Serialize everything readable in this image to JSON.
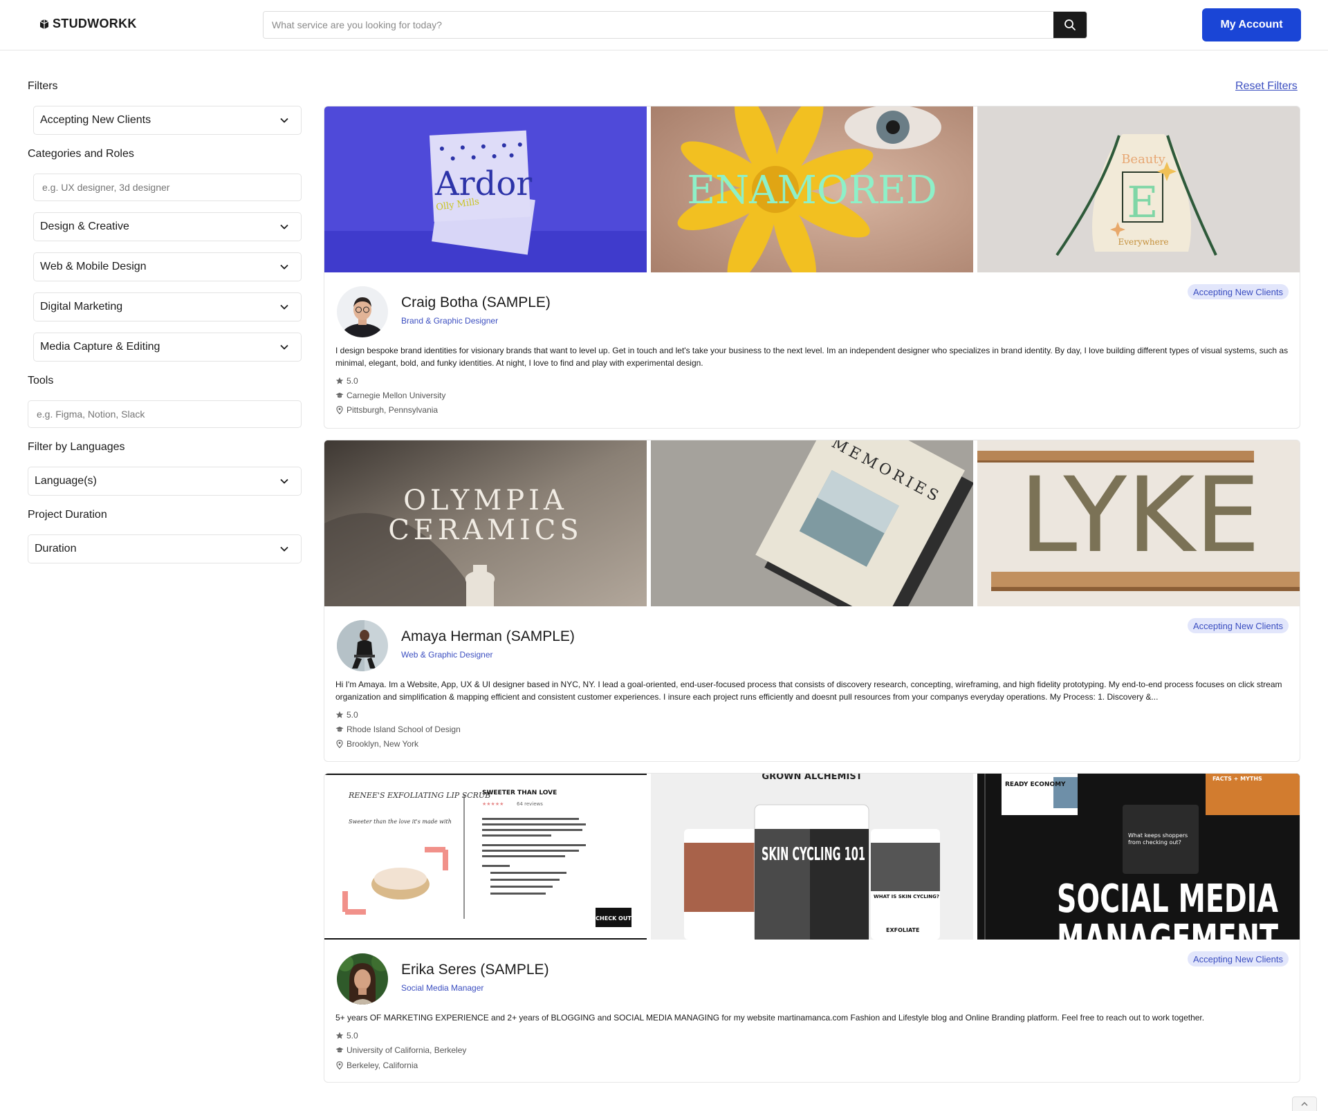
{
  "header": {
    "logo": "STUDWORKK",
    "search_placeholder": "What service are you looking for today?",
    "account_label": "My Account"
  },
  "sidebar": {
    "filters_heading": "Filters",
    "accepting_dropdown": "Accepting New Clients",
    "categories_heading": "Categories and Roles",
    "categories_placeholder": "e.g. UX designer, 3d designer",
    "categories": [
      "Design & Creative",
      "Web & Mobile Design",
      "Digital Marketing",
      "Media Capture & Editing"
    ],
    "tools_heading": "Tools",
    "tools_placeholder": "e.g. Figma, Notion, Slack",
    "languages_heading": "Filter by Languages",
    "languages_dropdown": "Language(s)",
    "duration_heading": "Project Duration",
    "duration_dropdown": "Duration"
  },
  "reset_filters": "Reset Filters",
  "profiles": [
    {
      "name": "Craig Botha (SAMPLE)",
      "role": "Brand & Graphic Designer",
      "badge": "Accepting New Clients",
      "bio": "I design bespoke brand identities for visionary brands that want to level up. Get in touch and let's take your business to the next level. Im an independent designer who specializes in brand identity. By day, I love building different types of visual systems, such as minimal, elegant, bold, and funky identities. At night, I love to find and play with experimental design.",
      "rating": "5.0",
      "school": "Carnegie Mellon University",
      "location": "Pittsburgh, Pennsylvania",
      "thumb_texts": [
        "Ardor",
        "Olly Mills",
        "ENAMORED",
        "Beauty",
        "E",
        "Everywhere"
      ]
    },
    {
      "name": "Amaya Herman (SAMPLE)",
      "role": "Web & Graphic Designer",
      "badge": "Accepting New Clients",
      "bio": "Hi I'm Amaya. Im a Website, App, UX & UI designer based in NYC, NY. I lead a goal-oriented, end-user-focused process that consists of discovery research, concepting, wireframing, and high fidelity prototyping. My end-to-end process focuses on click stream organization and simplification & mapping efficient and consistent customer experiences. I insure each project runs efficiently and doesnt pull resources from your companys everyday operations. My Process: 1. Discovery &...",
      "rating": "5.0",
      "school": "Rhode Island School of Design",
      "location": "Brooklyn, New York",
      "thumb_texts": [
        "OLYMPIA",
        "CERAMICS",
        "MEMORIES",
        "LYKE"
      ]
    },
    {
      "name": "Erika Seres (SAMPLE)",
      "role": "Social Media Manager",
      "badge": "Accepting New Clients",
      "bio": "5+ years OF MARKETING EXPERIENCE and 2+ years of BLOGGING and SOCIAL MEDIA MANAGING for my website martinamanca.com Fashion and Lifestyle blog and Online Branding platform. Feel free to reach out to work together.",
      "rating": "5.0",
      "school": "University of California, Berkeley",
      "location": "Berkeley, California",
      "thumb_texts": [
        "RENEE'S EXFOLIATING LIP SCRUB",
        "Sweeter than the love it's made with",
        "SWEETER THAN LOVE",
        "64 reviews",
        "CHECK OUT",
        "GROWN ALCHEMIST",
        "SKIN CYCLING 101",
        "WHAT IS SKIN CYCLING?",
        "EXFOLIATE",
        "SOCIAL MEDIA",
        "MANAGEMENT",
        "What keeps shoppers from checking out?",
        "FACTS + MYTHS",
        "READY ECONOMY"
      ]
    }
  ],
  "colors": {
    "accent": "#1a45d6",
    "link": "#3b4ec0",
    "badge_bg": "#e2e6fb"
  }
}
